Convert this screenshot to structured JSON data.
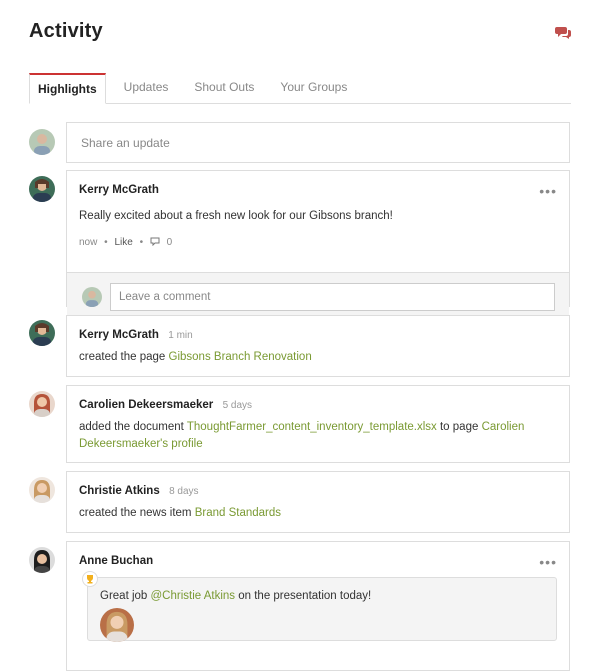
{
  "page": {
    "title": "Activity",
    "chat_icon": "chat-bubbles-icon"
  },
  "tabs": [
    {
      "label": "Highlights",
      "active": true
    },
    {
      "label": "Updates",
      "active": false
    },
    {
      "label": "Shout Outs",
      "active": false
    },
    {
      "label": "Your Groups",
      "active": false
    }
  ],
  "share": {
    "placeholder": "Share an update"
  },
  "posts": [
    {
      "author": "Kerry McGrath",
      "text": "Really excited about a fresh new look for our Gibsons branch!",
      "meta": {
        "time": "now",
        "like": "Like",
        "comments": "0"
      },
      "comment_placeholder": "Leave a comment",
      "more": "•••"
    },
    {
      "author": "Kerry McGrath",
      "time": "1 min",
      "text": "created the page ",
      "link": "Gibsons Branch Renovation"
    },
    {
      "author": "Carolien Dekeersmaeker",
      "time": "5 days",
      "text": "added the document ",
      "link": "ThoughtFarmer_content_inventory_template.xlsx",
      "text2": " to page ",
      "link2_line1": "Carolien",
      "link2_line2": "Dekeersmaeker's profile"
    },
    {
      "author": "Christie Atkins",
      "time": "8 days",
      "text": "created the news item ",
      "link": "Brand Standards"
    },
    {
      "author": "Anne Buchan",
      "shout_text": "Great job ",
      "mention": "@Christie Atkins",
      "shout_text2": " on the presentation today!",
      "more": "•••"
    }
  ],
  "colors": {
    "accent": "#7a9a33",
    "tab_active": "#cc3333",
    "chat_icon": "#c0504d"
  }
}
